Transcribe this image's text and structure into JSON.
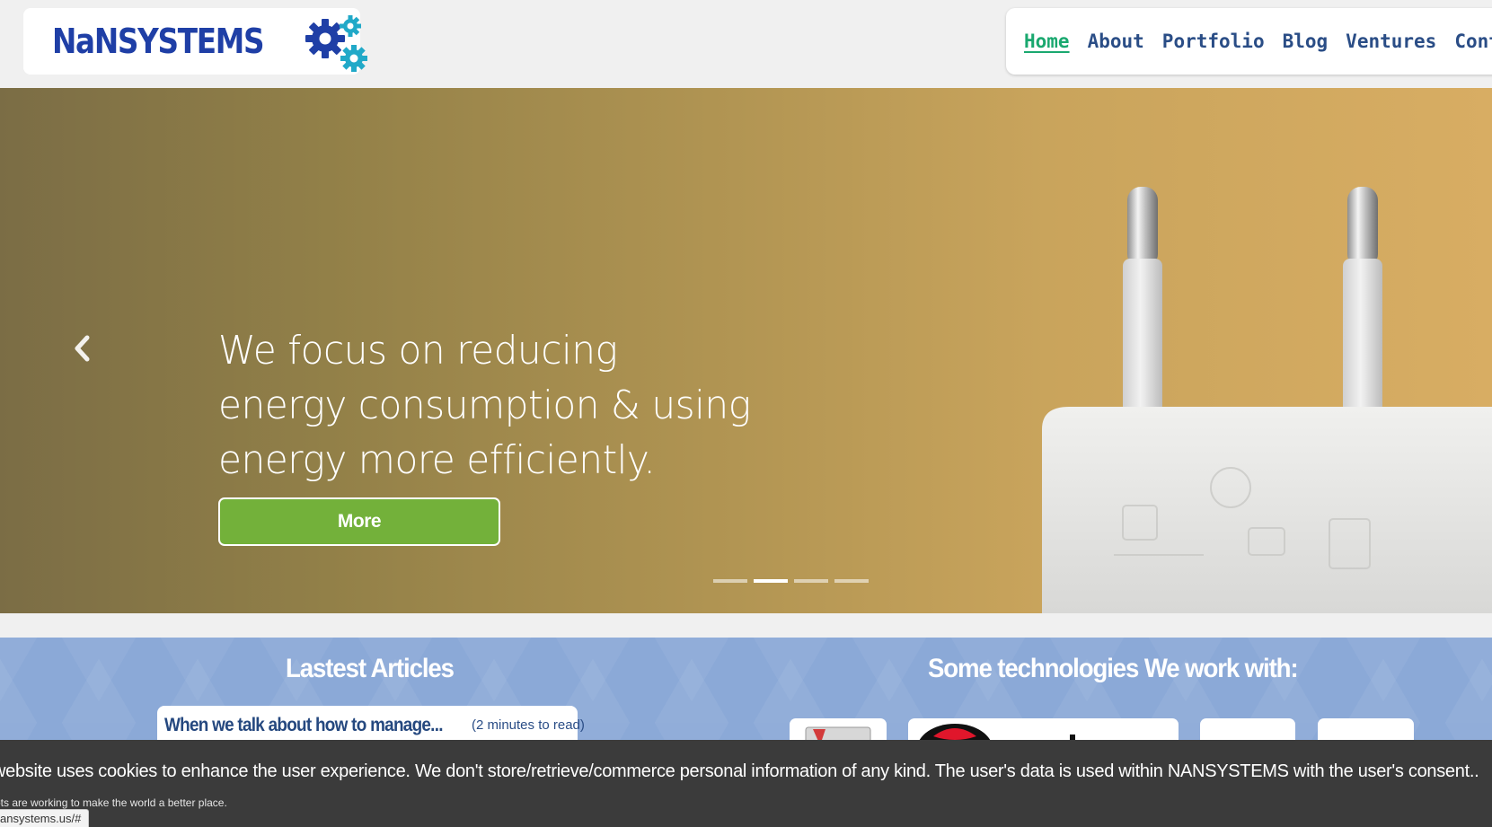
{
  "header": {
    "logo_text": "NaNSYSTEMS",
    "nav": [
      {
        "label": "Home",
        "active": true
      },
      {
        "label": "About",
        "active": false
      },
      {
        "label": "Portfolio",
        "active": false
      },
      {
        "label": "Blog",
        "active": false
      },
      {
        "label": "Ventures",
        "active": false
      },
      {
        "label": "Contact",
        "active": false
      }
    ]
  },
  "hero": {
    "headline": "We focus on reducing energy consumption & using energy more efficiently.",
    "button_label": "More",
    "prev_icon": "chevron-left-icon",
    "slide_count": 4,
    "active_slide": 2
  },
  "articles": {
    "title": "Lastest Articles",
    "items": [
      {
        "title": "When we talk about how to manage...",
        "read_time": "(2 minutes to read)"
      }
    ]
  },
  "technologies": {
    "title": "Some technologies We work with:"
  },
  "cookie_banner": {
    "text": "website uses cookies to enhance the user experience. We don't store/retrieve/commerce personal information of any kind. The user's data is used within NANSYSTEMS with the user's consent..",
    "subtext": "pts are working to make the world a better place."
  },
  "status_bar": {
    "url": "ansystems.us/#"
  },
  "colors": {
    "brand_blue": "#1f3fa6",
    "nav_blue": "#2a4d86",
    "nav_active_green": "#1aa86f",
    "gear_blue": "#1f3fa6",
    "gear_cyan": "#21a9c8",
    "button_green": "#73b13a",
    "band_blue": "#8ba9d7",
    "cookie_bg": "#3b3b3b"
  }
}
